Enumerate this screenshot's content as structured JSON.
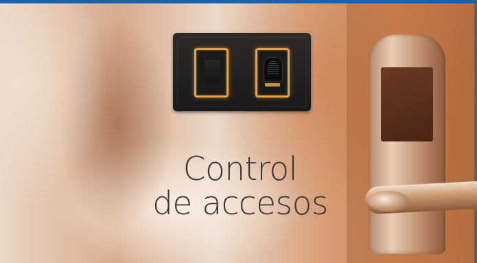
{
  "banner": {
    "title_line1": "Control",
    "title_line2": "de accesos",
    "accent_color": "#1a63ab",
    "device": {
      "keys": [
        {
          "name": "card-reader-key"
        },
        {
          "name": "fingerprint-reader-key"
        }
      ],
      "glow_color": "#e3a44a"
    }
  }
}
